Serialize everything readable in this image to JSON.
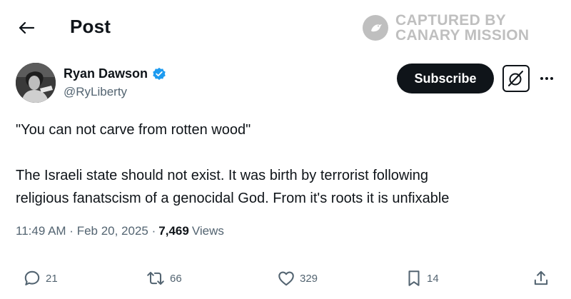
{
  "header": {
    "title": "Post"
  },
  "watermark": {
    "line1": "CAPTURED BY",
    "line2": "CANARY MISSION"
  },
  "author": {
    "name": "Ryan Dawson",
    "handle": "@RyLiberty"
  },
  "subscribe_label": "Subscribe",
  "post": {
    "line1": "\"You can not carve from rotten wood\"",
    "line2": "The Israeli state should not exist. It was birth by terrorist following",
    "line3": "religious fanatscism of a genocidal God. From it's roots it is unfixable"
  },
  "meta": {
    "time": "11:49 AM",
    "date": "Feb 20, 2025",
    "views_count": "7,469",
    "views_label": "Views"
  },
  "actions": {
    "replies": "21",
    "reposts": "66",
    "likes": "329",
    "bookmarks": "14"
  },
  "colors": {
    "text": "#0f1419",
    "muted": "#536471",
    "verified": "#1d9bf0",
    "watermark": "#8c8c8c"
  }
}
